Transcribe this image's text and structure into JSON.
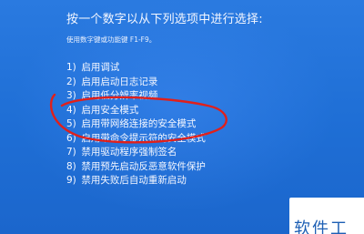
{
  "screen": {
    "title": "按一个数字以从下列选项中进行选择:",
    "instruction": "使用数字键或功能键 F1-F9。",
    "options": [
      {
        "number": "1)",
        "label": "启用调试"
      },
      {
        "number": "2)",
        "label": "启用启动日志记录"
      },
      {
        "number": "3)",
        "label": "启用低分辨率视频"
      },
      {
        "number": "4)",
        "label": "启用安全模式"
      },
      {
        "number": "5)",
        "label": "启用带网络连接的安全模式"
      },
      {
        "number": "6)",
        "label": "启用带命令提示符的安全模式"
      },
      {
        "number": "7)",
        "label": "禁用驱动程序强制签名"
      },
      {
        "number": "8)",
        "label": "禁用预先启动反恶意软件保护"
      },
      {
        "number": "9)",
        "label": "禁用失败后自动重新启动"
      }
    ],
    "highlight_color": "#e0201b",
    "background_color": "#1f6fd6"
  },
  "watermark": {
    "text": "软件工"
  }
}
